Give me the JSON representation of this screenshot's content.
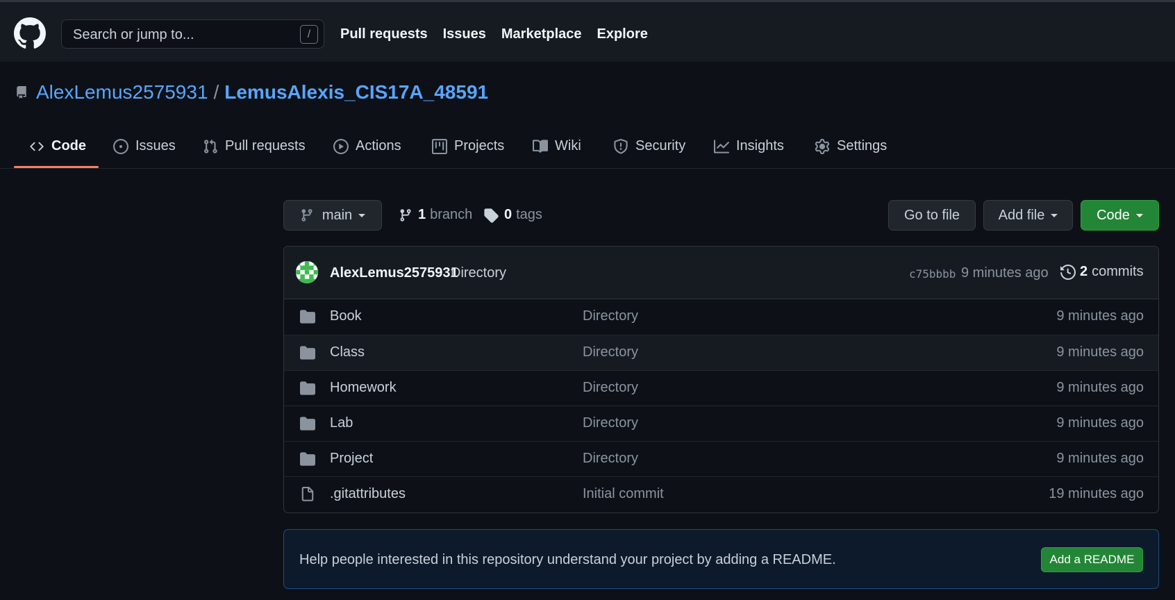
{
  "header": {
    "search_placeholder": "Search or jump to...",
    "search_shortcut": "/",
    "nav": [
      "Pull requests",
      "Issues",
      "Marketplace",
      "Explore"
    ]
  },
  "repo": {
    "owner": "AlexLemus2575931",
    "separator": "/",
    "name": "LemusAlexis_CIS17A_48591"
  },
  "tabs": [
    "Code",
    "Issues",
    "Pull requests",
    "Actions",
    "Projects",
    "Wiki",
    "Security",
    "Insights",
    "Settings"
  ],
  "controls": {
    "branch": "main",
    "branch_count": "1",
    "branch_label": "branch",
    "tag_count": "0",
    "tag_label": "tags",
    "go_to_file": "Go to file",
    "add_file": "Add file",
    "code": "Code"
  },
  "commit": {
    "author": "AlexLemus2575931",
    "message": "Directory",
    "sha": "c75bbbb",
    "time": "9 minutes ago",
    "count": "2",
    "count_label": "commits"
  },
  "files": [
    {
      "name": "Book",
      "type": "dir",
      "message": "Directory",
      "age": "9 minutes ago"
    },
    {
      "name": "Class",
      "type": "dir",
      "message": "Directory",
      "age": "9 minutes ago"
    },
    {
      "name": "Homework",
      "type": "dir",
      "message": "Directory",
      "age": "9 minutes ago"
    },
    {
      "name": "Lab",
      "type": "dir",
      "message": "Directory",
      "age": "9 minutes ago"
    },
    {
      "name": "Project",
      "type": "dir",
      "message": "Directory",
      "age": "9 minutes ago"
    },
    {
      "name": ".gitattributes",
      "type": "file",
      "message": "Initial commit",
      "age": "19 minutes ago"
    }
  ],
  "readme": {
    "text": "Help people interested in this repository understand your project by adding a README.",
    "button": "Add a README"
  },
  "colors": {
    "background": "#0d1117",
    "header": "#161b22",
    "link": "#58a6ff",
    "green": "#238636",
    "tab_underline": "#f78166"
  }
}
